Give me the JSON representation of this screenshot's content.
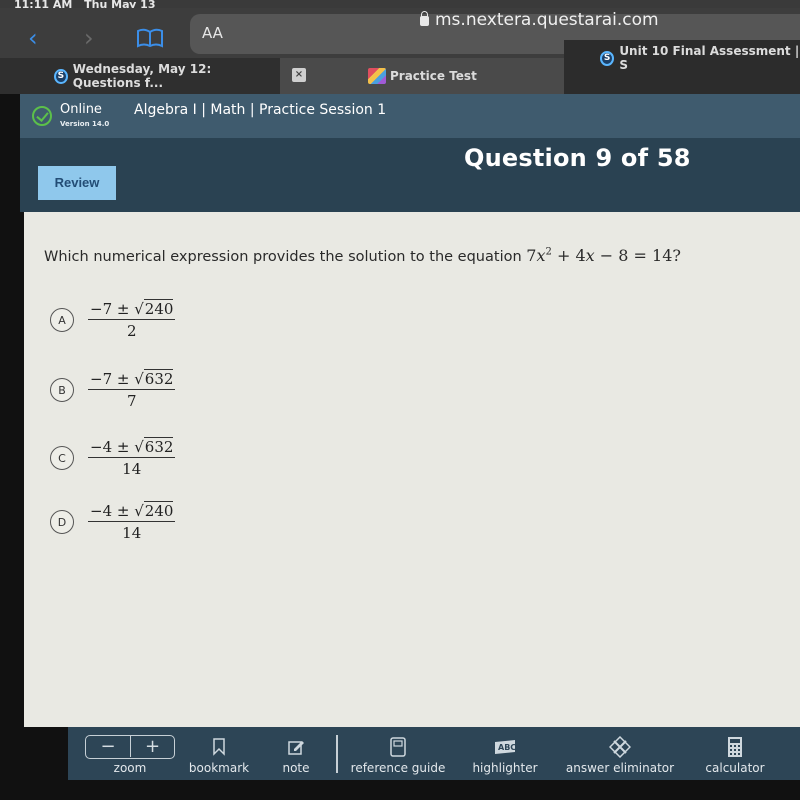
{
  "device_status": {
    "time": "11:11 AM",
    "date": "Thu May 13"
  },
  "browser": {
    "text_size_label": "AA",
    "url": "ms.nextera.questarai.com",
    "tabs": [
      {
        "title": "Wednesday, May 12: Questions f...",
        "icon": "schoology-icon"
      },
      {
        "title": "Practice Test",
        "icon": "practice-test-icon",
        "active": true
      },
      {
        "title": "Unit 10 Final Assessment | S",
        "icon": "schoology-icon"
      }
    ],
    "close_tab_glyph": "×",
    "s_glyph": "S"
  },
  "app": {
    "status_label": "Online",
    "version": "Version 14.0",
    "session_title": "Algebra I | Math | Practice Session 1",
    "review_label": "Review",
    "question_counter": "Question 9 of 58",
    "accent_color": "#8fc8ec",
    "status_color": "#5cc04a"
  },
  "question": {
    "prompt": "Which numerical expression provides the solution to the equation",
    "equation": {
      "a": "7",
      "var": "x",
      "exp": "2",
      "b_part": " + 4",
      "c_part": " − 8 = 14?"
    },
    "options": [
      {
        "letter": "A",
        "num_lead": "−7 ± ",
        "radicand": "240",
        "den": "2"
      },
      {
        "letter": "B",
        "num_lead": "−7 ± ",
        "radicand": "632",
        "den": "7"
      },
      {
        "letter": "C",
        "num_lead": "−4 ± ",
        "radicand": "632",
        "den": "14"
      },
      {
        "letter": "D",
        "num_lead": "−4 ± ",
        "radicand": "240",
        "den": "14"
      }
    ],
    "sqrt_glyph": "√"
  },
  "toolbar": {
    "zoom_out_glyph": "−",
    "zoom_in_glyph": "+",
    "tools": [
      {
        "label": "zoom"
      },
      {
        "label": "bookmark"
      },
      {
        "label": "note"
      },
      {
        "label": "reference guide"
      },
      {
        "label": "highlighter"
      },
      {
        "label": "answer eliminator"
      },
      {
        "label": "calculator"
      }
    ]
  }
}
